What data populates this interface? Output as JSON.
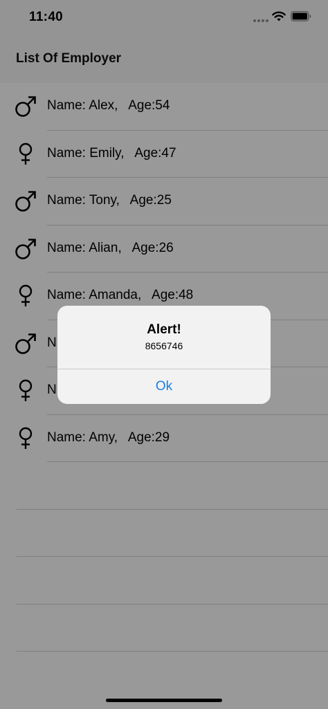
{
  "status_bar": {
    "time": "11:40",
    "icons": [
      "signal-dots-icon",
      "wifi-icon",
      "battery-icon"
    ]
  },
  "nav": {
    "title": "List Of Employer"
  },
  "employees": [
    {
      "text": "Name: Alex,   Age:54",
      "gender_icon": "male-icon"
    },
    {
      "text": "Name: Emily,   Age:47",
      "gender_icon": "female-icon"
    },
    {
      "text": "Name: Tony,   Age:25",
      "gender_icon": "male-icon"
    },
    {
      "text": "Name: Alian,   Age:26",
      "gender_icon": "male-icon"
    },
    {
      "text": "Name: Amanda,   Age:48",
      "gender_icon": "female-icon"
    },
    {
      "text": "N",
      "gender_icon": "male-icon"
    },
    {
      "text": "N",
      "gender_icon": "female-icon"
    },
    {
      "text": "Name: Amy,   Age:29",
      "gender_icon": "female-icon"
    }
  ],
  "alert": {
    "title": "Alert!",
    "message": "8656746",
    "ok_label": "Ok"
  },
  "colors": {
    "accent": "#1a7ee6",
    "overlay": "rgba(0,0,0,0.4)"
  }
}
